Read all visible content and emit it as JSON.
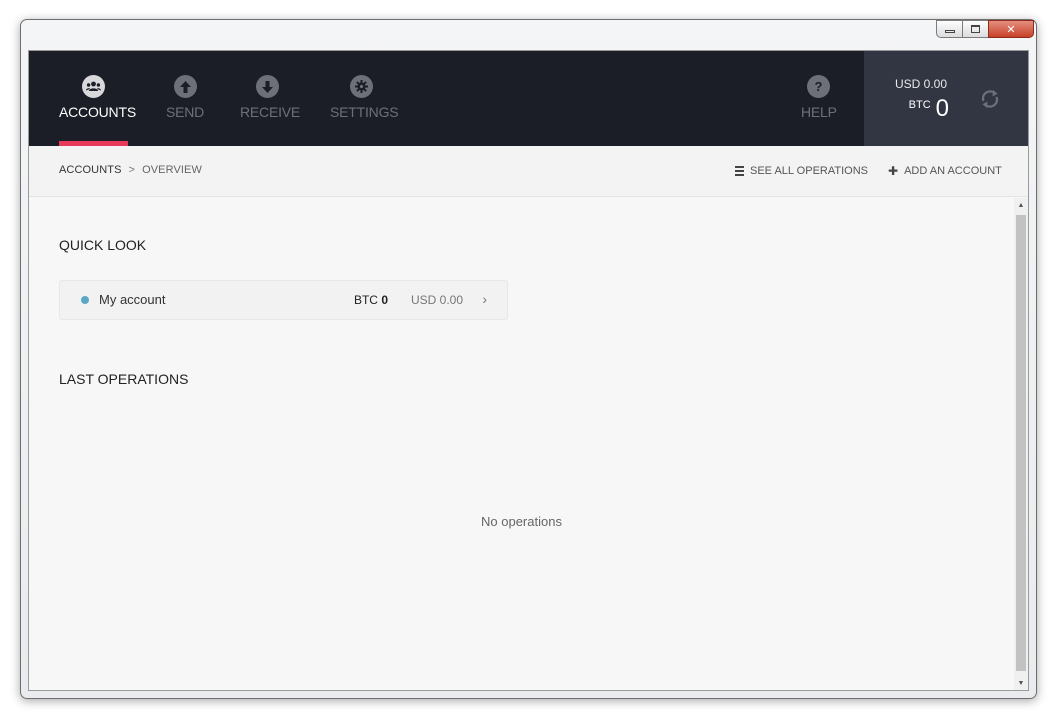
{
  "window": {
    "minimize_glyph": "",
    "maximize_glyph": "",
    "close_glyph": "✕"
  },
  "nav": {
    "items": [
      {
        "label": "ACCOUNTS",
        "icon": "users-icon",
        "active": true
      },
      {
        "label": "SEND",
        "icon": "arrow-up-icon",
        "active": false
      },
      {
        "label": "RECEIVE",
        "icon": "arrow-down-icon",
        "active": false
      },
      {
        "label": "SETTINGS",
        "icon": "gear-icon",
        "active": false
      }
    ],
    "help": {
      "label": "HELP",
      "icon_glyph": "?"
    }
  },
  "balance": {
    "usd": "USD 0.00",
    "btc_unit": "BTC",
    "btc_value": "0"
  },
  "breadcrumb": {
    "root": "ACCOUNTS",
    "separator": ">",
    "current": "OVERVIEW"
  },
  "actions": {
    "see_all": "SEE ALL OPERATIONS",
    "add_account": "ADD AN ACCOUNT",
    "add_glyph": "✚"
  },
  "quick_look": {
    "title": "QUICK LOOK",
    "accounts": [
      {
        "name": "My account",
        "btc_unit": "BTC",
        "btc_value": "0",
        "usd": "USD 0.00",
        "chevron": "›"
      }
    ]
  },
  "last_operations": {
    "title": "LAST OPERATIONS",
    "empty_text": "No operations"
  },
  "colors": {
    "topbar": "#1c1e27",
    "balance_panel": "#323542",
    "accent": "#e9395a",
    "account_dot": "#5aa8c7"
  }
}
